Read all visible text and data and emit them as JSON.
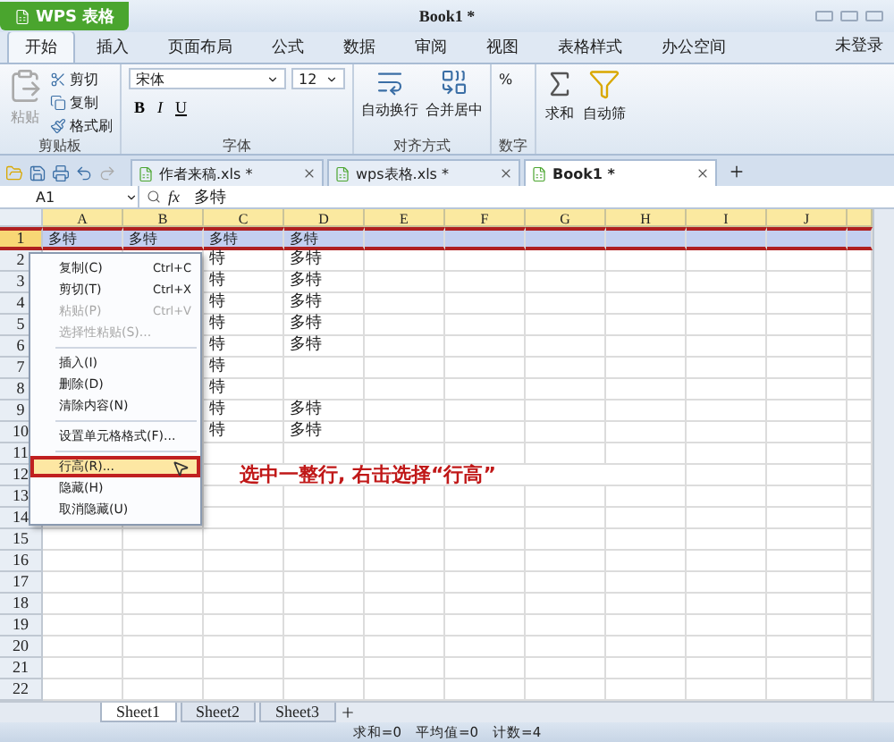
{
  "app_button": "WPS 表格",
  "title": "Book1 *",
  "ribbon_tabs": [
    {
      "label": "开始",
      "selected": true
    },
    {
      "label": "插入",
      "selected": false
    },
    {
      "label": "页面布局",
      "selected": false
    },
    {
      "label": "公式",
      "selected": false
    },
    {
      "label": "数据",
      "selected": false
    },
    {
      "label": "审阅",
      "selected": false
    },
    {
      "label": "视图",
      "selected": false
    },
    {
      "label": "表格样式",
      "selected": false
    },
    {
      "label": "办公空间",
      "selected": false
    }
  ],
  "user": "未登录",
  "clipboard": {
    "label": "剪贴板",
    "paste": "粘贴",
    "items": [
      "剪切",
      "复制",
      "格式刷"
    ]
  },
  "font": {
    "label": "字体",
    "name": "宋体",
    "size": "12",
    "styles": [
      "B",
      "I",
      "U"
    ]
  },
  "alignment": {
    "label": "对齐方式",
    "buttons": [
      "自动换行",
      "合并居中"
    ]
  },
  "number": {
    "label": "数字",
    "symbol": "%"
  },
  "sum": "求和",
  "filter": "自动筛",
  "doc_tabs": [
    {
      "label": "作者来稿.xls *",
      "selected": false
    },
    {
      "label": "wps表格.xls *",
      "selected": false
    },
    {
      "label": "Book1 *",
      "selected": true
    }
  ],
  "formula_bar": {
    "cell": "A1",
    "function_label": "fx",
    "value": "多特"
  },
  "columns": [
    "A",
    "B",
    "C",
    "D",
    "E",
    "F",
    "G",
    "H",
    "I",
    "J"
  ],
  "rows": [
    {
      "number": "1",
      "selected": true,
      "cells": {
        "A": "多特",
        "B": "多特",
        "C": "多特",
        "D": "多特"
      }
    },
    {
      "number": "2",
      "selected": false,
      "cells": {
        "C": "特",
        "D": "多特"
      }
    },
    {
      "number": "3",
      "selected": false,
      "cells": {
        "C": "特",
        "D": "多特"
      }
    },
    {
      "number": "4",
      "selected": false,
      "cells": {
        "C": "特",
        "D": "多特"
      }
    },
    {
      "number": "5",
      "selected": false,
      "cells": {
        "C": "特",
        "D": "多特"
      }
    },
    {
      "number": "6",
      "selected": false,
      "cells": {
        "C": "特",
        "D": "多特"
      }
    },
    {
      "number": "7",
      "selected": false,
      "cells": {
        "C": "特"
      }
    },
    {
      "number": "8",
      "selected": false,
      "cells": {
        "C": "特"
      }
    },
    {
      "number": "9",
      "selected": false,
      "cells": {
        "C": "特",
        "D": "多特"
      }
    },
    {
      "number": "10",
      "selected": false,
      "cells": {
        "C": "特",
        "D": "多特"
      }
    },
    {
      "number": "11",
      "selected": false,
      "cells": {}
    },
    {
      "number": "12",
      "selected": false,
      "cells": {}
    },
    {
      "number": "13",
      "selected": false,
      "cells": {}
    },
    {
      "number": "14",
      "selected": false,
      "cells": {}
    },
    {
      "number": "15",
      "selected": false,
      "cells": {}
    },
    {
      "number": "16",
      "selected": false,
      "cells": {}
    },
    {
      "number": "17",
      "selected": false,
      "cells": {}
    },
    {
      "number": "18",
      "selected": false,
      "cells": {}
    },
    {
      "number": "19",
      "selected": false,
      "cells": {}
    },
    {
      "number": "20",
      "selected": false,
      "cells": {}
    },
    {
      "number": "21",
      "selected": false,
      "cells": {}
    },
    {
      "number": "22",
      "selected": false,
      "cells": {}
    }
  ],
  "context_menu": [
    {
      "kind": "item",
      "label": "复制(C)",
      "shortcut": "Ctrl+C",
      "disabled": false,
      "selected": false
    },
    {
      "kind": "item",
      "label": "剪切(T)",
      "shortcut": "Ctrl+X",
      "disabled": false,
      "selected": false
    },
    {
      "kind": "item",
      "label": "粘贴(P)",
      "shortcut": "Ctrl+V",
      "disabled": true,
      "selected": false
    },
    {
      "kind": "item",
      "label": "选择性粘贴(S)...",
      "disabled": true,
      "selected": false
    },
    {
      "kind": "separator"
    },
    {
      "kind": "item",
      "label": "插入(I)",
      "disabled": false,
      "selected": false
    },
    {
      "kind": "item",
      "label": "删除(D)",
      "disabled": false,
      "selected": false
    },
    {
      "kind": "item",
      "label": "清除内容(N)",
      "disabled": false,
      "selected": false
    },
    {
      "kind": "separator"
    },
    {
      "kind": "item",
      "label": "设置单元格格式(F)...",
      "disabled": false,
      "selected": false
    },
    {
      "kind": "separator"
    },
    {
      "kind": "item",
      "label": "行高(R)...",
      "disabled": false,
      "selected": true
    },
    {
      "kind": "item",
      "label": "隐藏(H)",
      "disabled": false,
      "selected": false
    },
    {
      "kind": "item",
      "label": "取消隐藏(U)",
      "disabled": false,
      "selected": false
    }
  ],
  "annotation": "选中一整行, 右击选择“行高”",
  "sheet_tabs": [
    {
      "label": "Sheet1",
      "selected": true
    },
    {
      "label": "Sheet2",
      "selected": false
    },
    {
      "label": "Sheet3",
      "selected": false
    }
  ],
  "status": [
    "求和=0",
    "平均值=0",
    "计数=4"
  ]
}
